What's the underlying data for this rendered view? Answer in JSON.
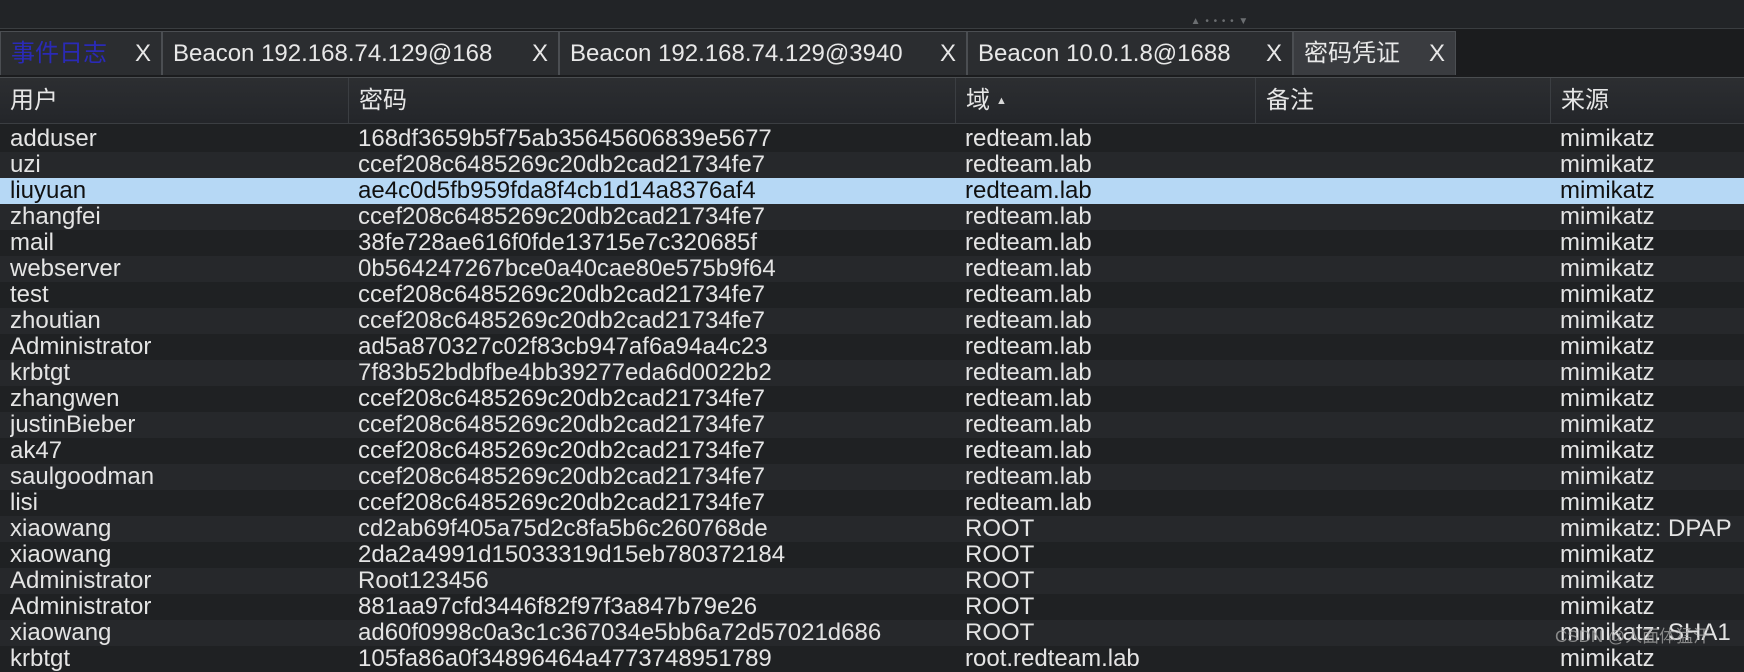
{
  "tabs": [
    {
      "label": "事件日志",
      "close": "X"
    },
    {
      "label": "Beacon 192.168.74.129@168",
      "close": "X"
    },
    {
      "label": "Beacon 192.168.74.129@3940",
      "close": "X"
    },
    {
      "label": "Beacon 10.0.1.8@1688",
      "close": "X"
    },
    {
      "label": "密码凭证",
      "close": "X"
    }
  ],
  "columns": {
    "user": "用户",
    "password": "密码",
    "realm": "域",
    "note": "备注",
    "source": "来源"
  },
  "sort_indicator": "▲",
  "rows": [
    {
      "user": "adduser",
      "password": "168df3659b5f75ab35645606839e5677",
      "realm": "redteam.lab",
      "note": "",
      "source": "mimikatz"
    },
    {
      "user": "uzi",
      "password": "ccef208c6485269c20db2cad21734fe7",
      "realm": "redteam.lab",
      "note": "",
      "source": "mimikatz"
    },
    {
      "user": "liuyuan",
      "password": "ae4c0d5fb959fda8f4cb1d14a8376af4",
      "realm": "redteam.lab",
      "note": "",
      "source": "mimikatz"
    },
    {
      "user": "zhangfei",
      "password": "ccef208c6485269c20db2cad21734fe7",
      "realm": "redteam.lab",
      "note": "",
      "source": "mimikatz"
    },
    {
      "user": "mail",
      "password": "38fe728ae616f0fde13715e7c320685f",
      "realm": "redteam.lab",
      "note": "",
      "source": "mimikatz"
    },
    {
      "user": "webserver",
      "password": "0b564247267bce0a40cae80e575b9f64",
      "realm": "redteam.lab",
      "note": "",
      "source": "mimikatz"
    },
    {
      "user": "test",
      "password": "ccef208c6485269c20db2cad21734fe7",
      "realm": "redteam.lab",
      "note": "",
      "source": "mimikatz"
    },
    {
      "user": "zhoutian",
      "password": "ccef208c6485269c20db2cad21734fe7",
      "realm": "redteam.lab",
      "note": "",
      "source": "mimikatz"
    },
    {
      "user": "Administrator",
      "password": "ad5a870327c02f83cb947af6a94a4c23",
      "realm": "redteam.lab",
      "note": "",
      "source": "mimikatz"
    },
    {
      "user": "krbtgt",
      "password": "7f83b52bdbfbe4bb39277eda6d0022b2",
      "realm": "redteam.lab",
      "note": "",
      "source": "mimikatz"
    },
    {
      "user": "zhangwen",
      "password": "ccef208c6485269c20db2cad21734fe7",
      "realm": "redteam.lab",
      "note": "",
      "source": "mimikatz"
    },
    {
      "user": "justinBieber",
      "password": "ccef208c6485269c20db2cad21734fe7",
      "realm": "redteam.lab",
      "note": "",
      "source": "mimikatz"
    },
    {
      "user": "ak47",
      "password": "ccef208c6485269c20db2cad21734fe7",
      "realm": "redteam.lab",
      "note": "",
      "source": "mimikatz"
    },
    {
      "user": "saulgoodman",
      "password": "ccef208c6485269c20db2cad21734fe7",
      "realm": "redteam.lab",
      "note": "",
      "source": "mimikatz"
    },
    {
      "user": "lisi",
      "password": "ccef208c6485269c20db2cad21734fe7",
      "realm": "redteam.lab",
      "note": "",
      "source": "mimikatz"
    },
    {
      "user": "xiaowang",
      "password": "cd2ab69f405a75d2c8fa5b6c260768de",
      "realm": "ROOT",
      "note": "",
      "source": "mimikatz: DPAP"
    },
    {
      "user": "xiaowang",
      "password": "2da2a4991d15033319d15eb780372184",
      "realm": "ROOT",
      "note": "",
      "source": "mimikatz"
    },
    {
      "user": "Administrator",
      "password": "Root123456",
      "realm": "ROOT",
      "note": "",
      "source": "mimikatz"
    },
    {
      "user": "Administrator",
      "password": "881aa97cfd3446f82f97f3a847b79e26",
      "realm": "ROOT",
      "note": "",
      "source": "mimikatz"
    },
    {
      "user": "xiaowang",
      "password": "ad60f0998c0a3c1c367034e5bb6a72d57021d686",
      "realm": "ROOT",
      "note": "",
      "source": "mimikatz: SHA1"
    },
    {
      "user": "krbtgt",
      "password": "105fa86a0f34896464a4773748951789",
      "realm": "root.redteam.lab",
      "note": "",
      "source": "mimikatz"
    }
  ],
  "selected_row_index": 2,
  "watermark": "CSDN @人面体猛汗"
}
